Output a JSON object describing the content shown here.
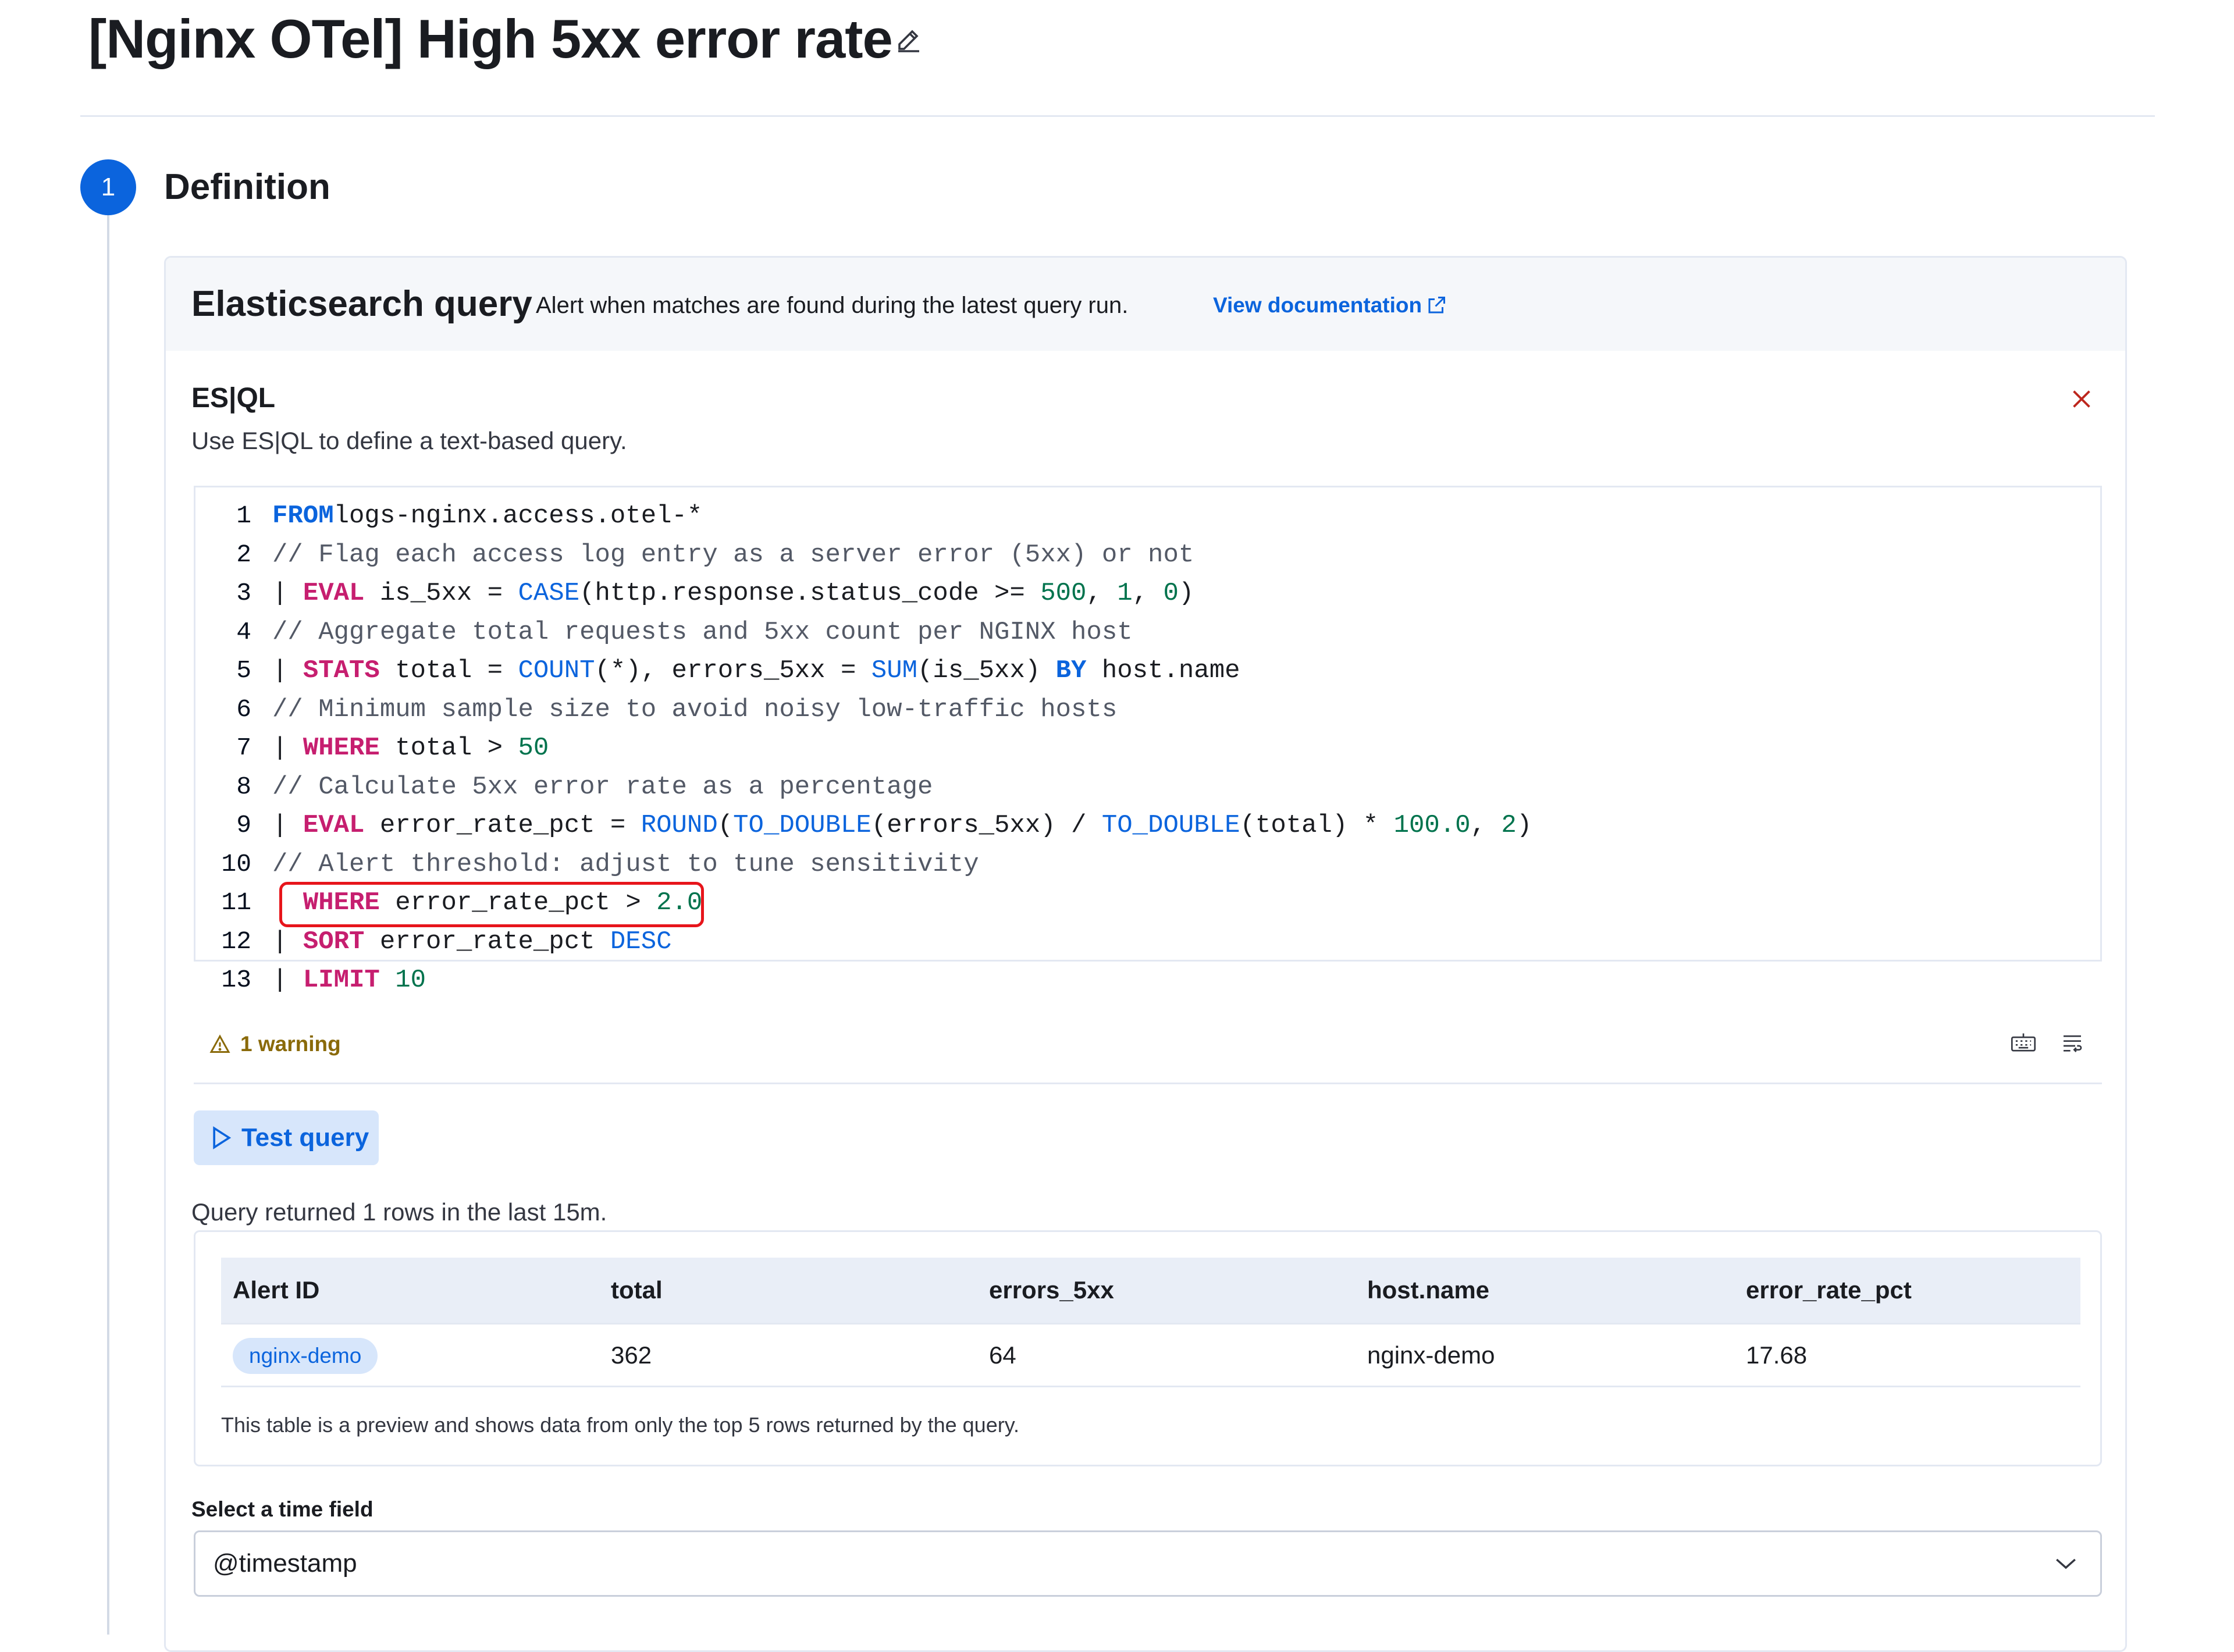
{
  "page": {
    "title": "[Nginx OTel] High 5xx error rate"
  },
  "step": {
    "number": "1",
    "title": "Definition"
  },
  "rule_type": {
    "title": "Elasticsearch query",
    "description": "Alert when matches are found during the latest query run.",
    "doc_link": "View documentation"
  },
  "esql": {
    "title": "ES|QL",
    "description": "Use ES|QL to define a text-based query.",
    "lines": [
      {
        "n": "1",
        "tokens": [
          [
            "kw-blue",
            "FROM"
          ],
          [
            "",
            "logs-nginx.access.otel-*"
          ]
        ]
      },
      {
        "n": "2",
        "tokens": [
          [
            "cmt",
            "// Flag each access log entry as a server error (5xx) or not"
          ]
        ]
      },
      {
        "n": "3",
        "tokens": [
          [
            "",
            "| "
          ],
          [
            "kw",
            "EVAL"
          ],
          [
            "",
            " is_5xx = "
          ],
          [
            "fn",
            "CASE"
          ],
          [
            "",
            "(http.response.status_code >= "
          ],
          [
            "num",
            "500"
          ],
          [
            "",
            ", "
          ],
          [
            "num",
            "1"
          ],
          [
            "",
            ", "
          ],
          [
            "num",
            "0"
          ],
          [
            "",
            ")"
          ]
        ]
      },
      {
        "n": "4",
        "tokens": [
          [
            "cmt",
            "// Aggregate total requests and 5xx count per NGINX host"
          ]
        ]
      },
      {
        "n": "5",
        "tokens": [
          [
            "",
            "| "
          ],
          [
            "kw",
            "STATS"
          ],
          [
            "",
            " total = "
          ],
          [
            "fn",
            "COUNT"
          ],
          [
            "",
            "(*), errors_5xx = "
          ],
          [
            "fn",
            "SUM"
          ],
          [
            "",
            "(is_5xx) "
          ],
          [
            "kw-blue",
            "BY"
          ],
          [
            "",
            " host.name"
          ]
        ]
      },
      {
        "n": "6",
        "tokens": [
          [
            "cmt",
            "// Minimum sample size to avoid noisy low-traffic hosts"
          ]
        ]
      },
      {
        "n": "7",
        "tokens": [
          [
            "",
            "| "
          ],
          [
            "kw",
            "WHERE"
          ],
          [
            "",
            " total > "
          ],
          [
            "num",
            "50"
          ]
        ]
      },
      {
        "n": "8",
        "tokens": [
          [
            "cmt",
            "// Calculate 5xx error rate as a percentage"
          ]
        ]
      },
      {
        "n": "9",
        "tokens": [
          [
            "",
            "| "
          ],
          [
            "kw",
            "EVAL"
          ],
          [
            "",
            " error_rate_pct = "
          ],
          [
            "fn",
            "ROUND"
          ],
          [
            "",
            "("
          ],
          [
            "fn",
            "TO_DOUBLE"
          ],
          [
            "",
            "(errors_5xx) / "
          ],
          [
            "fn",
            "TO_DOUBLE"
          ],
          [
            "",
            "(total) * "
          ],
          [
            "num",
            "100.0"
          ],
          [
            "",
            ", "
          ],
          [
            "num",
            "2"
          ],
          [
            "",
            ")"
          ]
        ]
      },
      {
        "n": "10",
        "tokens": [
          [
            "cmt",
            "// Alert threshold: adjust to tune sensitivity"
          ]
        ]
      },
      {
        "n": "11",
        "tokens": [
          [
            "",
            "  "
          ],
          [
            "kw",
            "WHERE"
          ],
          [
            "",
            " error_rate_pct > "
          ],
          [
            "num",
            "2.0"
          ]
        ]
      },
      {
        "n": "12",
        "tokens": [
          [
            "",
            "| "
          ],
          [
            "kw",
            "SORT"
          ],
          [
            "",
            " error_rate_pct "
          ],
          [
            "fn",
            "DESC"
          ]
        ]
      },
      {
        "n": "13",
        "tokens": [
          [
            "",
            "| "
          ],
          [
            "kw",
            "LIMIT"
          ],
          [
            "",
            " "
          ],
          [
            "num",
            "10"
          ]
        ]
      }
    ],
    "warning": "1 warning"
  },
  "test_query": {
    "button_label": "Test query",
    "status": "Query returned 1 rows in the last 15m."
  },
  "results": {
    "columns": [
      "Alert ID",
      "total",
      "errors_5xx",
      "host.name",
      "error_rate_pct"
    ],
    "rows": [
      {
        "alert_id": "nginx-demo",
        "total": "362",
        "errors_5xx": "64",
        "host_name": "nginx-demo",
        "error_rate_pct": "17.68"
      }
    ],
    "note": "This table is a preview and shows data from only the top 5 rows returned by the query."
  },
  "time_field": {
    "label": "Select a time field",
    "value": "@timestamp"
  },
  "colors": {
    "primary": "#0b64dd",
    "keyword": "#c61e6f",
    "number": "#00734d",
    "highlight": "#e7151b",
    "warning": "#8a6a0a"
  }
}
